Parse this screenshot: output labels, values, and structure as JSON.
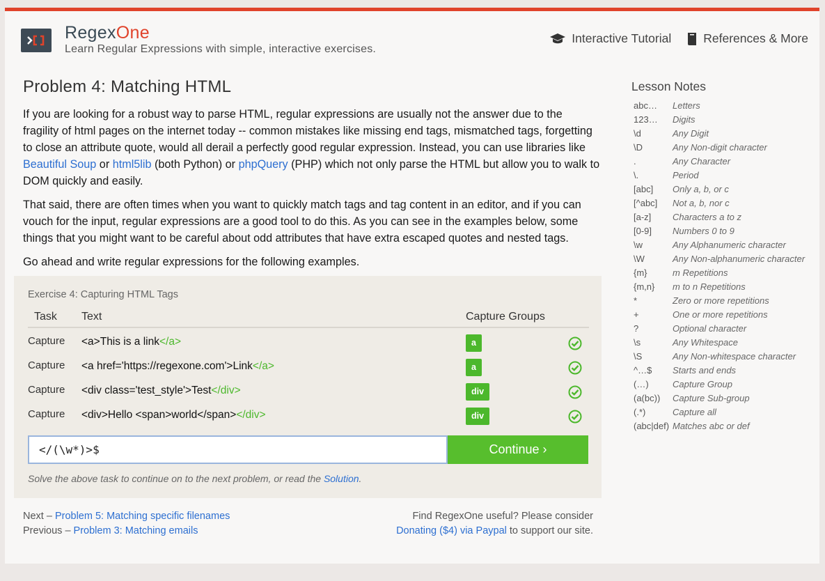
{
  "brand": {
    "name_main": "Regex",
    "name_accent": "One",
    "tagline": "Learn Regular Expressions with simple, interactive exercises."
  },
  "nav": {
    "tutorial": "Interactive Tutorial",
    "references": "References & More"
  },
  "problem": {
    "title": "Problem 4: Matching HTML",
    "p1_a": "If you are looking for a robust way to parse HTML, regular expressions are usually not the answer due to the fragility of html pages on the internet today -- common mistakes like missing end tags, mismatched tags, forgetting to close an attribute quote, would all derail a perfectly good regular expression. Instead, you can use libraries like ",
    "link_bs": "Beautiful Soup",
    "p1_b": " or ",
    "link_h5": "html5lib",
    "p1_c": " (both Python) or ",
    "link_pq": "phpQuery",
    "p1_d": " (PHP) which not only parse the HTML but allow you to walk to DOM quickly and easily.",
    "p2": "That said, there are often times when you want to quickly match tags and tag content in an editor, and if you can vouch for the input, regular expressions are a good tool to do this. As you can see in the examples below, some things that you might want to be careful about odd attributes that have extra escaped quotes and nested tags.",
    "p3": "Go ahead and write regular expressions for the following examples."
  },
  "exercise": {
    "title": "Exercise 4: Capturing HTML Tags",
    "headers": {
      "task": "Task",
      "text": "Text",
      "groups": "Capture Groups"
    },
    "rows": [
      {
        "task": "Capture",
        "text_open": "<a>This is a link",
        "text_close": "</a>",
        "group": "a"
      },
      {
        "task": "Capture",
        "text_open": "<a href='https://regexone.com'>Link",
        "text_close": "</a>",
        "group": "a"
      },
      {
        "task": "Capture",
        "text_open": "<div class='test_style'>Test",
        "text_close": "</div>",
        "group": "div"
      },
      {
        "task": "Capture",
        "text_open": "<div>Hello <span>world</span>",
        "text_close": "</div>",
        "group": "div"
      }
    ],
    "input_value": "</(\\w*)>$",
    "continue_label": "Continue ›",
    "hint_a": "Solve the above task to continue on to the next problem, or read the ",
    "hint_link": "Solution",
    "hint_b": "."
  },
  "footer": {
    "next_prefix": "Next – ",
    "next_link": "Problem 5: Matching specific filenames",
    "prev_prefix": "Previous – ",
    "prev_link": "Problem 3: Matching emails",
    "support_a": "Find RegexOne useful? Please consider",
    "support_link": "Donating ($4) via Paypal",
    "support_b": " to support our site."
  },
  "notes": {
    "title": "Lesson Notes",
    "items": [
      {
        "sym": "abc…",
        "desc": "Letters"
      },
      {
        "sym": "123…",
        "desc": "Digits"
      },
      {
        "sym": "\\d",
        "desc": "Any Digit"
      },
      {
        "sym": "\\D",
        "desc": "Any Non-digit character"
      },
      {
        "sym": ".",
        "desc": "Any Character"
      },
      {
        "sym": "\\.",
        "desc": "Period"
      },
      {
        "sym": "[abc]",
        "desc": "Only a, b, or c"
      },
      {
        "sym": "[^abc]",
        "desc": "Not a, b, nor c"
      },
      {
        "sym": "[a-z]",
        "desc": "Characters a to z"
      },
      {
        "sym": "[0-9]",
        "desc": "Numbers 0 to 9"
      },
      {
        "sym": "\\w",
        "desc": "Any Alphanumeric character"
      },
      {
        "sym": "\\W",
        "desc": "Any Non-alphanumeric character"
      },
      {
        "sym": "{m}",
        "desc": "m Repetitions"
      },
      {
        "sym": "{m,n}",
        "desc": "m to n Repetitions"
      },
      {
        "sym": "*",
        "desc": "Zero or more repetitions"
      },
      {
        "sym": "+",
        "desc": "One or more repetitions"
      },
      {
        "sym": "?",
        "desc": "Optional character"
      },
      {
        "sym": "\\s",
        "desc": "Any Whitespace"
      },
      {
        "sym": "\\S",
        "desc": "Any Non-whitespace character"
      },
      {
        "sym": "^…$",
        "desc": "Starts and ends"
      },
      {
        "sym": "(…)",
        "desc": "Capture Group"
      },
      {
        "sym": "(a(bc))",
        "desc": "Capture Sub-group"
      },
      {
        "sym": "(.*)",
        "desc": "Capture all"
      },
      {
        "sym": "(abc|def)",
        "desc": "Matches abc or def"
      }
    ]
  },
  "colors": {
    "accent": "#e0432b",
    "success": "#4cb82c",
    "link": "#2d6fd1"
  }
}
